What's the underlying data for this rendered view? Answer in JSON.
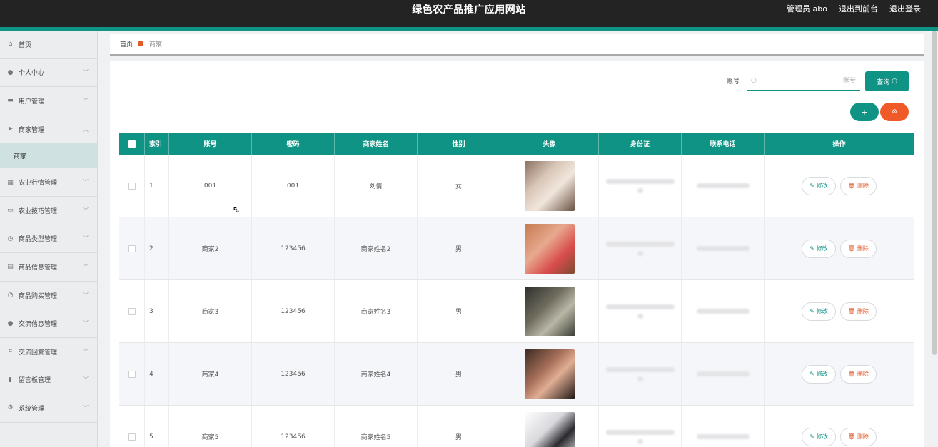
{
  "header": {
    "title": "绿色农产品推广应用网站",
    "admin_label": "管理员 abo",
    "to_frontend": "退出到前台",
    "logout": "退出登录"
  },
  "sidebar": {
    "items": [
      {
        "label": "首页",
        "icon": "home-icon",
        "glyph": "⌂",
        "expandable": false
      },
      {
        "label": "个人中心",
        "icon": "user-icon",
        "glyph": "●",
        "expandable": true
      },
      {
        "label": "用户管理",
        "icon": "card-icon",
        "glyph": "▬",
        "expandable": true
      },
      {
        "label": "商家管理",
        "icon": "send-icon",
        "glyph": "➤",
        "expandable": true,
        "expanded": true
      },
      {
        "label": "农业行情管理",
        "icon": "grid-icon",
        "glyph": "▦",
        "expandable": true
      },
      {
        "label": "农业技巧管理",
        "icon": "monitor-icon",
        "glyph": "▭",
        "expandable": true
      },
      {
        "label": "商品类型管理",
        "icon": "clock-icon",
        "glyph": "◷",
        "expandable": true
      },
      {
        "label": "商品信息管理",
        "icon": "doc-icon",
        "glyph": "▤",
        "expandable": true
      },
      {
        "label": "商品购买管理",
        "icon": "gauge-icon",
        "glyph": "◔",
        "expandable": true
      },
      {
        "label": "交流信息管理",
        "icon": "user-icon",
        "glyph": "●",
        "expandable": true
      },
      {
        "label": "交流回复管理",
        "icon": "frame-icon",
        "glyph": "⌗",
        "expandable": true
      },
      {
        "label": "留言板管理",
        "icon": "bar-chart-icon",
        "glyph": "▮",
        "expandable": true
      },
      {
        "label": "系统管理",
        "icon": "settings-icon",
        "glyph": "⚙",
        "expandable": true
      }
    ],
    "sub_item": "商家"
  },
  "breadcrumb": {
    "home": "首页",
    "current": "商家"
  },
  "search": {
    "label": "账号",
    "placeholder": "账号",
    "button": "查询"
  },
  "actions": {
    "add": "+",
    "delete": "⊗"
  },
  "table": {
    "columns": [
      "索引",
      "账号",
      "密码",
      "商家姓名",
      "性别",
      "头像",
      "身份证",
      "联系电话",
      "操作"
    ],
    "edit_label": "修改",
    "delete_label": "删除",
    "rows": [
      {
        "index": "1",
        "account": "001",
        "password": "001",
        "name": "刘倩",
        "gender": "女",
        "avatar_bg": "linear-gradient(135deg,#8b7060 0%,#d9c7b8 35%,#f1e6dc 60%,#6a5043 100%)"
      },
      {
        "index": "2",
        "account": "商家2",
        "password": "123456",
        "name": "商家姓名2",
        "gender": "男",
        "avatar_bg": "linear-gradient(135deg,#c47a4e 0%,#e8a98f 40%,#d84c4c 70%,#7e4a33 100%)"
      },
      {
        "index": "3",
        "account": "商家3",
        "password": "123456",
        "name": "商家姓名3",
        "gender": "男",
        "avatar_bg": "linear-gradient(135deg,#2d2f2a 0%,#6f6c5e 40%,#b9b7a6 65%,#3a3c35 100%)"
      },
      {
        "index": "4",
        "account": "商家4",
        "password": "123456",
        "name": "商家姓名4",
        "gender": "男",
        "avatar_bg": "linear-gradient(135deg,#3b2a22 0%,#a8705a 40%,#e0ad94 60%,#1e1714 100%)"
      },
      {
        "index": "5",
        "account": "商家5",
        "password": "123456",
        "name": "商家姓名5",
        "gender": "男",
        "avatar_bg": "linear-gradient(135deg,#ffffff 0%,#d8d8dc 40%,#2a2a2e 65%,#f2f2f2 100%)"
      }
    ]
  }
}
